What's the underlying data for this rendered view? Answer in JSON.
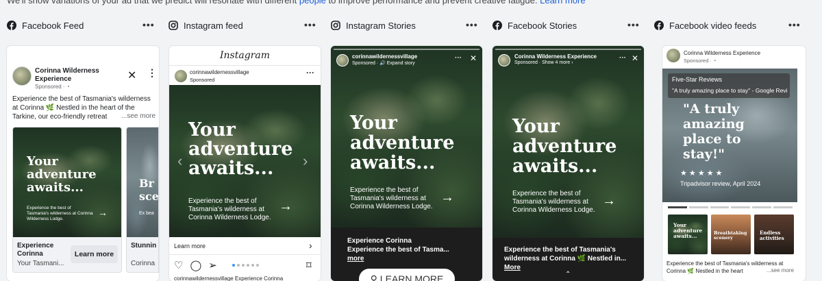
{
  "intro": {
    "text": "We'll show variations of your ad that we predict will resonate with different ",
    "link": "people",
    "rest": " to improve performance and prevent creative fatigue.",
    "learn": "Learn more"
  },
  "placements": [
    {
      "label": "Facebook Feed",
      "icon": "facebook-icon"
    },
    {
      "label": "Instagram feed",
      "icon": "instagram-icon"
    },
    {
      "label": "Instagram Stories",
      "icon": "instagram-icon"
    },
    {
      "label": "Facebook Stories",
      "icon": "facebook-icon"
    },
    {
      "label": "Facebook video feeds",
      "icon": "facebook-icon"
    }
  ],
  "more_glyph": "•••",
  "fb_feed": {
    "page_name": "Corinna Wilderness Experience",
    "sponsored": "Sponsored · ",
    "body": "Experience the best of Tasmania's wilderness at Corinna 🌿 Nestled in the heart of the Tarkine, our eco-friendly retreat",
    "see_more": "...see more",
    "headline": "Your adventure awaits...",
    "sub": "Experience the best of Tasmania's wilderness at Corinna Wilderness Lodge.",
    "card_title": "Experience Corinna",
    "card_sub": "Your Tasmani...",
    "cta": "Learn more",
    "card2_headline": "Br sce",
    "card2_sub": "Ex bea",
    "card2_title": "Stunnin Landsc",
    "card2_desc": "Corinna"
  },
  "ig_feed": {
    "logo": "Instagram",
    "handle": "corinnawildernessvillage",
    "sponsored": "Sponsored",
    "headline": "Your adventure awaits...",
    "sub": "Experience the best of Tasmania's wilderness at Corinna Wilderness Lodge.",
    "cta": "Learn more",
    "caption": "corinnawildernessvillage Experience Corinna"
  },
  "ig_story": {
    "handle": "corinnawildernessvillage",
    "meta": "Sponsored · 🔊 Expand story",
    "headline": "Your adventure awaits...",
    "sub": "Experience the best of Tasmania's wilderness at Corinna Wilderness Lodge.",
    "cap_title": "Experience Corinna",
    "cap_line": "Experience the best of Tasma...",
    "more": "more",
    "cta": "LEARN MORE"
  },
  "fb_story": {
    "page_name": "Corinna Wilderness Experience",
    "meta": "Sponsored · Show 4 more ›",
    "headline": "Your adventure awaits...",
    "sub": "Experience the best of Tasmania's wilderness at Corinna Wilderness Lodge.",
    "caption": "Experience the best of Tasmania's wilderness at Corinna 🌿 Nestled in...",
    "more": "More"
  },
  "fb_video": {
    "page_name": "Corinna Wilderness Experience",
    "sponsored": "Sponsored · ",
    "badge_title": "Five-Star Reviews",
    "badge_quote": "\"A truly amazing place to stay\" - Google Revi",
    "headline": "\"A truly amazing place to stay!\"",
    "stars": "★ ★ ★ ★ ★",
    "review": "Tripadvisor review, April 2024",
    "thumbs": [
      "Your adventure awaits...",
      "Breathtaking scenery",
      "Endless activities"
    ],
    "body": "Experience the best of Tasmania's wilderness at Corinna 🌿 Nestled in the heart",
    "see_more": "...see more"
  },
  "colors": {
    "fb_blue": "#1877f2",
    "link": "#1a5fd8",
    "dark": "#1d1d1d"
  }
}
